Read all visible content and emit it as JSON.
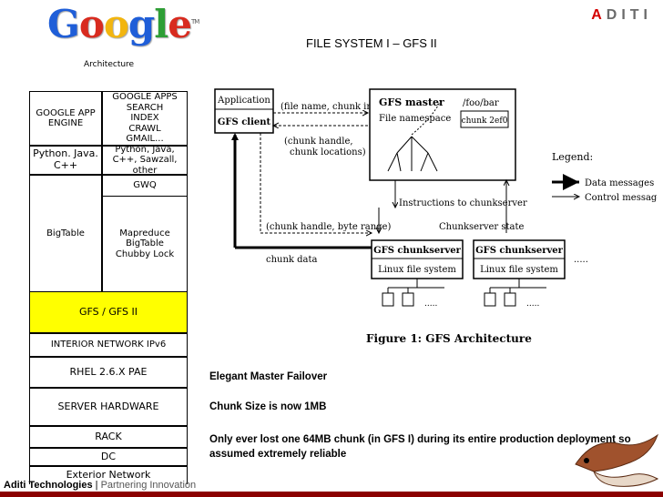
{
  "branding": {
    "google_letters": [
      {
        "ch": "G",
        "color": "#1f5ed8"
      },
      {
        "ch": "o",
        "color": "#d82b1f"
      },
      {
        "ch": "o",
        "color": "#f2b50f"
      },
      {
        "ch": "g",
        "color": "#1f5ed8"
      },
      {
        "ch": "l",
        "color": "#2e9e35"
      },
      {
        "ch": "e",
        "color": "#d82b1f"
      }
    ],
    "google_tm": "TM",
    "aditi_first": "A",
    "aditi_rest": "DITI"
  },
  "slide": {
    "title": "FILE SYSTEM I – GFS II",
    "architecture_label": "Architecture"
  },
  "stack": {
    "google_app_engine": "GOOGLE APP ENGINE",
    "google_apps": "GOOGLE APPS",
    "search": "SEARCH",
    "index": "INDEX",
    "crawl": "CRAWL",
    "gmail": "GMAIL...",
    "python_java_cpp": "Python. Java. C++",
    "languages": "Python, Java, C++, Sawzall, other",
    "gwq": "GWQ",
    "bigtable": "BigTable",
    "mapreduce": "Mapreduce",
    "bigtable_small": "BigTable",
    "chubby_lock": "Chubby Lock",
    "gfs": "GFS / GFS II",
    "interior_network": "INTERIOR NETWORK IPv6",
    "rhel": "RHEL 2.6.X PAE",
    "server_hardware": "SERVER HARDWARE",
    "rack": "RACK",
    "dc": "DC",
    "exterior_network": "Exterior Network",
    "gfs_highlight_color": "#ffff00"
  },
  "figure": {
    "application": "Application",
    "gfs_client": "GFS client",
    "file_name_chunk_index": "(file name, chunk index)",
    "chunk_handle_locations_1": "(chunk handle,",
    "chunk_handle_locations_2": "chunk locations)",
    "gfs_master": "GFS master",
    "file_namespace": "File namespace",
    "foo_bar": "/foo/bar",
    "chunk_2ef0": "chunk 2ef0",
    "legend": "Legend:",
    "data_messages": "Data messages",
    "control_messages": "Control messages",
    "instructions": "Instructions to chunkserver",
    "chunkserver_state": "Chunkserver state",
    "chunk_handle_byte_range": "(chunk handle, byte range)",
    "chunk_data": "chunk data",
    "gfs_chunkserver_1": "GFS chunkserver",
    "gfs_chunkserver_2": "GFS chunkserver",
    "linux_fs_1": "Linux file system",
    "linux_fs_2": "Linux file system",
    "ellipsis": ".....",
    "caption": "Figure 1: GFS Architecture"
  },
  "notes": {
    "failover": "Elegant Master Failover",
    "chunk_size": "Chunk Size is now 1MB",
    "chunk_loss_line1": "Only ever lost one 64MB chunk (in GFS I) during its entire production deployment so",
    "chunk_loss_line2": "assumed extremely reliable"
  },
  "footer": {
    "brand": "Aditi Technologies",
    "separator": " | ",
    "tagline": "Partnering Innovation",
    "bar_color": "#8b0000"
  }
}
